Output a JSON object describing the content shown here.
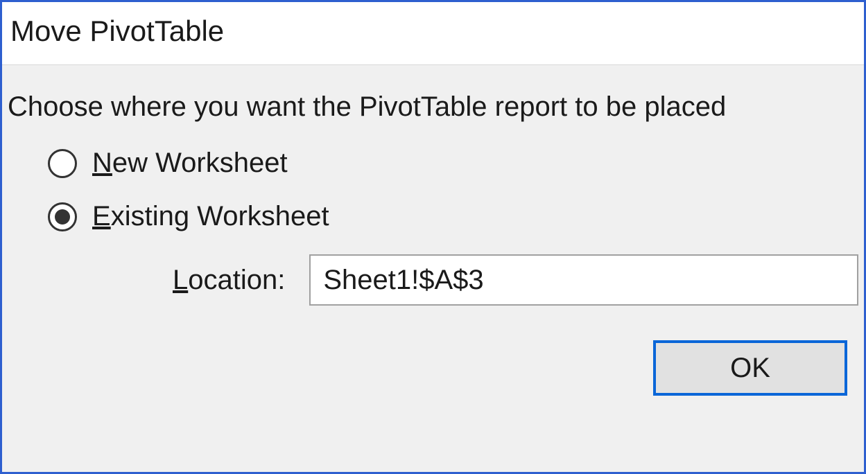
{
  "dialog": {
    "title": "Move PivotTable",
    "instruction": "Choose where you want the PivotTable report to be placed",
    "options": {
      "new_worksheet": {
        "prefix": "N",
        "rest": "ew Worksheet",
        "selected": false
      },
      "existing_worksheet": {
        "prefix": "E",
        "rest": "xisting Worksheet",
        "selected": true
      }
    },
    "location": {
      "label_prefix": "L",
      "label_rest": "ocation:",
      "value": "Sheet1!$A$3"
    },
    "buttons": {
      "ok": "OK"
    }
  }
}
